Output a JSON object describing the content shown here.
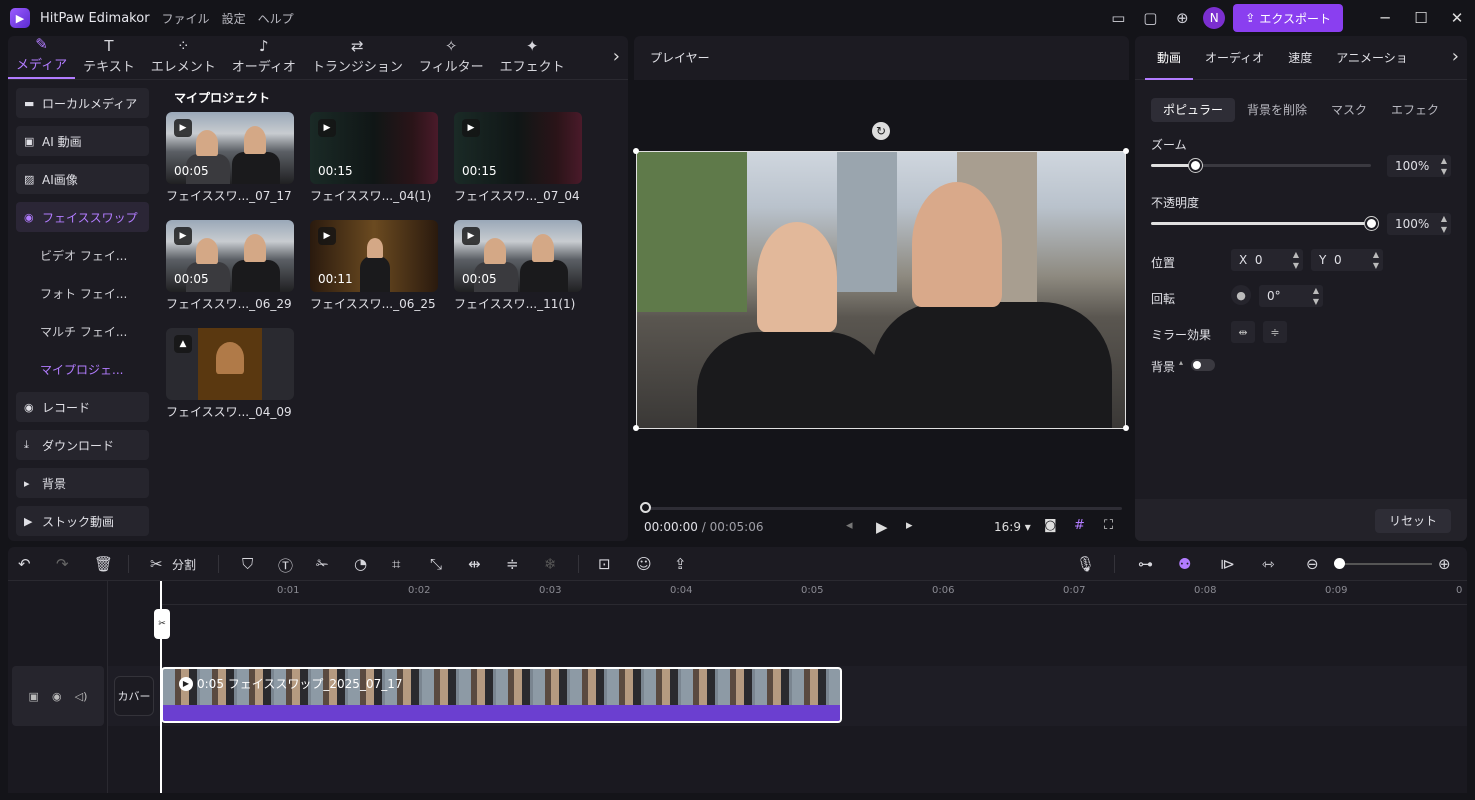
{
  "app": {
    "name": "HitPaw Edimakor",
    "menus": [
      "ファイル",
      "設定",
      "ヘルプ"
    ],
    "export_label": "エクスポート",
    "avatar_letter": "N",
    "accent": "#8a3ff0"
  },
  "media_tabs": [
    "メディア",
    "テキスト",
    "エレメント",
    "オーディオ",
    "トランジション",
    "フィルター",
    "エフェクト"
  ],
  "sidebar": {
    "items": [
      {
        "label": "ローカルメディア"
      },
      {
        "label": "AI 動画"
      },
      {
        "label": "AI画像"
      },
      {
        "label": "フェイススワップ"
      },
      {
        "label": "ビデオ フェイ..."
      },
      {
        "label": "フォト フェイ..."
      },
      {
        "label": "マルチ フェイ..."
      },
      {
        "label": "マイプロジェ..."
      },
      {
        "label": "レコード"
      },
      {
        "label": "ダウンロード"
      },
      {
        "label": "背景"
      },
      {
        "label": "ストック動画"
      }
    ]
  },
  "media": {
    "section_title": "マイプロジェクト",
    "items": [
      {
        "name": "フェイススワ..._07_17",
        "duration": "00:05"
      },
      {
        "name": "フェイススワ..._04(1)",
        "duration": "00:15"
      },
      {
        "name": "フェイススワ..._07_04",
        "duration": "00:15"
      },
      {
        "name": "フェイススワ..._06_29",
        "duration": "00:05"
      },
      {
        "name": "フェイススワ..._06_25",
        "duration": "00:11"
      },
      {
        "name": "フェイススワ..._11(1)",
        "duration": "00:05"
      },
      {
        "name": "フェイススワ..._04_09",
        "duration": ""
      }
    ]
  },
  "player": {
    "title": "プレイヤー",
    "current": "00:00:00",
    "total": "/ 00:05:06",
    "ratio": "16:9"
  },
  "properties": {
    "tabs": [
      "動画",
      "オーディオ",
      "速度",
      "アニメーショ"
    ],
    "subtabs": [
      "ポピュラー",
      "背景を削除",
      "マスク",
      "エフェク"
    ],
    "zoom_label": "ズーム",
    "zoom_value": "100%",
    "zoom_level": 0.2,
    "opacity_label": "不透明度",
    "opacity_value": "100%",
    "opacity_level": 1.0,
    "position_label": "位置",
    "x_label": "X",
    "x_value": "0",
    "y_label": "Y",
    "y_value": "0",
    "rotate_label": "回転",
    "rotate_value": "0°",
    "mirror_label": "ミラー効果",
    "background_label": "背景",
    "reset_label": "リセット"
  },
  "toolbar": {
    "split_label": "分割"
  },
  "timeline": {
    "ticks": [
      "0:01",
      "0:02",
      "0:03",
      "0:04",
      "0:05",
      "0:06",
      "0:07",
      "0:08",
      "0:09",
      "0"
    ],
    "cover_label": "カバー",
    "clip_label": "0:05 フェイススワップ_2025_07_17"
  }
}
